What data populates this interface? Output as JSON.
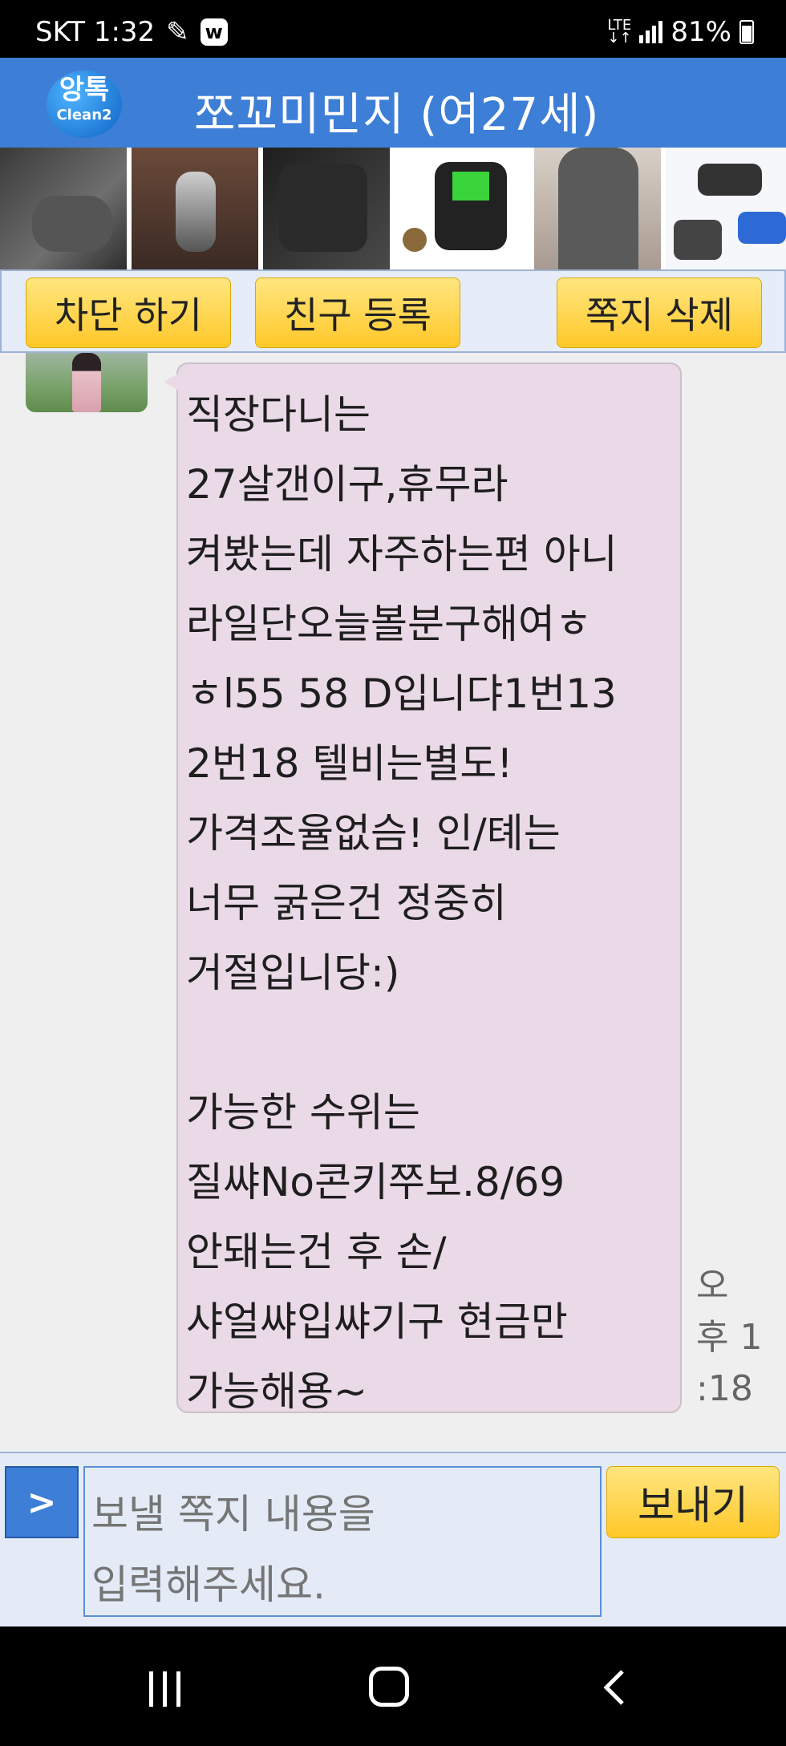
{
  "status_bar": {
    "carrier_time": "SKT 1:32",
    "app_badge": "w",
    "network": "LTE",
    "battery": "81%"
  },
  "header": {
    "logo_main": "앙톡",
    "logo_sub": "Clean2",
    "title": "쪼꼬미민지 (여27세)"
  },
  "ads": [
    "lumbar-cushion-ad",
    "car-key-case-ad",
    "car-seat-ad",
    "fishing-reel-ad",
    "sweater-ad",
    "drone-ad"
  ],
  "actions": {
    "block": "차단 하기",
    "add_friend": "친구 등록",
    "delete": "쪽지 삭제"
  },
  "message": {
    "lines": [
      "직장다니는",
      "27살갠이구,휴무라",
      "켜봤는데 자주하는편 아니",
      "라일단오늘볼분구해여ㅎ",
      "ㅎl55 58 D입니댜1번13",
      "2번18 텔비는별도!",
      "가격조율없슴! 인/톄는",
      "너무 굵은건 정중히",
      "거절입니당:)",
      "",
      "가능한 수위는",
      "질쌰No콘키쭈보.8/69",
      "안돼는건 후 손/",
      "샤얼쌰입쌰기구 현금만",
      "가능해용~"
    ],
    "time_lines": [
      "오",
      "후 1",
      ":18"
    ]
  },
  "compose": {
    "arrow": ">",
    "placeholder": "보낼 쪽지 내용을\n입력해주세요.",
    "send": "보내기"
  },
  "colors": {
    "header_blue": "#3d7ed6",
    "bubble_pink": "#ead9e6",
    "button_yellow": "#ffd84a"
  }
}
